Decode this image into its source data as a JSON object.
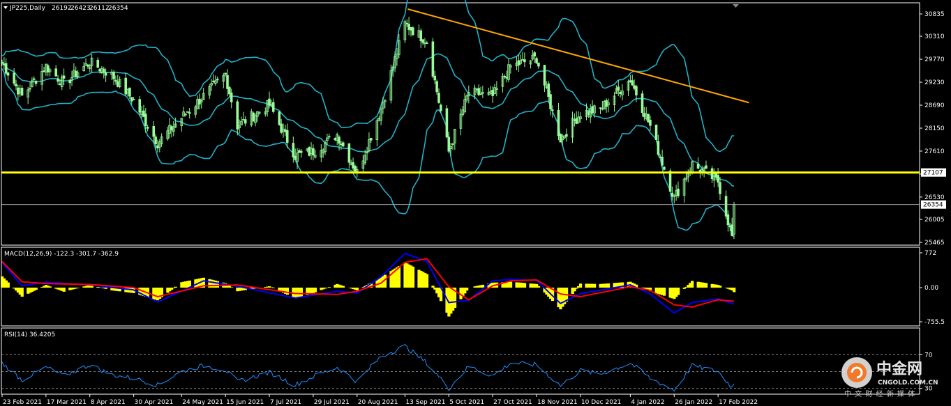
{
  "colors": {
    "background": "#000000",
    "frame": "#ffffff",
    "candle": "#98fb98",
    "bollinger": "#20b2c8",
    "trendline": "#ffa500",
    "support": "#ffff00",
    "macd_hist": "#ffff00",
    "macd_main": "#0000ff",
    "macd_signal": "#ff0000",
    "rsi": "#1e90ff"
  },
  "chart_data": [
    {
      "type": "candlestick",
      "symbol_header": "JP225,Daily",
      "ohlc_header": [
        "26192",
        "26423",
        "26112",
        "26354"
      ],
      "y_ticks": [
        "30835",
        "30310",
        "29770",
        "29230",
        "28690",
        "28150",
        "27610",
        "27070",
        "26530",
        "26005",
        "25465"
      ],
      "ylim": [
        25465,
        30835
      ],
      "support_level": 27107,
      "support_label": "27107",
      "last_price": 26354,
      "last_price_label": "26354",
      "trendline": {
        "from": [
          "13 Sep 2021",
          30950
        ],
        "to": [
          "~22 Feb 2022",
          28750
        ]
      },
      "x_tick_labels": [
        "23 Feb 2021",
        "17 Mar 2021",
        "8 Apr 2021",
        "30 Apr 2021",
        "24 May 2021",
        "15 Jun 2021",
        "7 Jul 2021",
        "29 Jul 2021",
        "20 Aug 2021",
        "13 Sep 2021",
        "5 Oct 2021",
        "27 Oct 2021",
        "18 Nov 2021",
        "10 Dec 2021",
        "4 Jan 2022",
        "26 Jan 2022",
        "17 Feb 2022"
      ],
      "close_path": [
        [
          "23 Feb 2021",
          29700
        ],
        [
          "5 Mar 2021",
          28900
        ],
        [
          "17 Mar 2021",
          29600
        ],
        [
          "26 Mar 2021",
          29200
        ],
        [
          "8 Apr 2021",
          29700
        ],
        [
          "19 Apr 2021",
          29400
        ],
        [
          "30 Apr 2021",
          28800
        ],
        [
          "12 May 2021",
          27800
        ],
        [
          "24 May 2021",
          28400
        ],
        [
          "4 Jun 2021",
          28900
        ],
        [
          "15 Jun 2021",
          29400
        ],
        [
          "21 Jun 2021",
          28200
        ],
        [
          "7 Jul 2021",
          28700
        ],
        [
          "20 Jul 2021",
          27500
        ],
        [
          "29 Jul 2021",
          27600
        ],
        [
          "10 Aug 2021",
          28000
        ],
        [
          "20 Aug 2021",
          27100
        ],
        [
          "1 Sep 2021",
          28600
        ],
        [
          "13 Sep 2021",
          30600
        ],
        [
          "24 Sep 2021",
          30200
        ],
        [
          "5 Oct 2021",
          27600
        ],
        [
          "15 Oct 2021",
          29000
        ],
        [
          "27 Oct 2021",
          28900
        ],
        [
          "5 Nov 2021",
          29600
        ],
        [
          "18 Nov 2021",
          29800
        ],
        [
          "30 Nov 2021",
          27900
        ],
        [
          "10 Dec 2021",
          28500
        ],
        [
          "20 Dec 2021",
          28600
        ],
        [
          "4 Jan 2022",
          29300
        ],
        [
          "14 Jan 2022",
          28200
        ],
        [
          "26 Jan 2022",
          26500
        ],
        [
          "4 Feb 2022",
          27300
        ],
        [
          "17 Feb 2022",
          26900
        ],
        [
          "24 Feb 2022",
          25600
        ],
        [
          "25 Feb 2022",
          26354
        ]
      ]
    },
    {
      "type": "histogram+line",
      "title": "MACD(12,26,9) -122.3 -301.7 -362.9",
      "y_ticks": [
        "772",
        "0.00",
        "-755.5"
      ],
      "ylim": [
        -755.5,
        772
      ],
      "histogram": [
        [
          "23 Feb 2021",
          250
        ],
        [
          "5 Mar 2021",
          -200
        ],
        [
          "17 Mar 2021",
          60
        ],
        [
          "26 Mar 2021",
          -90
        ],
        [
          "8 Apr 2021",
          60
        ],
        [
          "19 Apr 2021",
          -60
        ],
        [
          "30 Apr 2021",
          -120
        ],
        [
          "12 May 2021",
          -280
        ],
        [
          "24 May 2021",
          120
        ],
        [
          "4 Jun 2021",
          220
        ],
        [
          "15 Jun 2021",
          100
        ],
        [
          "21 Jun 2021",
          -80
        ],
        [
          "7 Jul 2021",
          30
        ],
        [
          "20 Jul 2021",
          -240
        ],
        [
          "29 Jul 2021",
          -120
        ],
        [
          "10 Aug 2021",
          80
        ],
        [
          "20 Aug 2021",
          -60
        ],
        [
          "1 Sep 2021",
          230
        ],
        [
          "13 Sep 2021",
          560
        ],
        [
          "24 Sep 2021",
          300
        ],
        [
          "5 Oct 2021",
          -640
        ],
        [
          "15 Oct 2021",
          0
        ],
        [
          "27 Oct 2021",
          110
        ],
        [
          "5 Nov 2021",
          130
        ],
        [
          "18 Nov 2021",
          80
        ],
        [
          "30 Nov 2021",
          -480
        ],
        [
          "10 Dec 2021",
          90
        ],
        [
          "20 Dec 2021",
          80
        ],
        [
          "4 Jan 2022",
          130
        ],
        [
          "14 Jan 2022",
          -80
        ],
        [
          "26 Jan 2022",
          -250
        ],
        [
          "4 Feb 2022",
          150
        ],
        [
          "17 Feb 2022",
          60
        ],
        [
          "24 Feb 2022",
          -60
        ],
        [
          "25 Feb 2022",
          -100
        ]
      ],
      "series": [
        {
          "values": [
            [
              "23 Feb 2021",
              560
            ],
            [
              "5 Mar 2021",
              40
            ],
            [
              "17 Mar 2021",
              120
            ],
            [
              "8 Apr 2021",
              60
            ],
            [
              "30 Apr 2021",
              -50
            ],
            [
              "12 May 2021",
              -320
            ],
            [
              "4 Jun 2021",
              150
            ],
            [
              "21 Jun 2021",
              30
            ],
            [
              "20 Jul 2021",
              -230
            ],
            [
              "10 Aug 2021",
              -80
            ],
            [
              "20 Aug 2021",
              -120
            ],
            [
              "1 Sep 2021",
              240
            ],
            [
              "13 Sep 2021",
              760
            ],
            [
              "24 Sep 2021",
              580
            ],
            [
              "5 Oct 2021",
              -330
            ],
            [
              "15 Oct 2021",
              -280
            ],
            [
              "27 Oct 2021",
              150
            ],
            [
              "5 Nov 2021",
              180
            ],
            [
              "18 Nov 2021",
              160
            ],
            [
              "30 Nov 2021",
              -350
            ],
            [
              "10 Dec 2021",
              -130
            ],
            [
              "4 Jan 2022",
              60
            ],
            [
              "14 Jan 2022",
              -140
            ],
            [
              "26 Jan 2022",
              -560
            ],
            [
              "4 Feb 2022",
              -330
            ],
            [
              "17 Feb 2022",
              -250
            ],
            [
              "25 Feb 2022",
              -362.9
            ]
          ]
        },
        {
          "values": [
            [
              "23 Feb 2021",
              580
            ],
            [
              "5 Mar 2021",
              130
            ],
            [
              "17 Mar 2021",
              90
            ],
            [
              "8 Apr 2021",
              70
            ],
            [
              "30 Apr 2021",
              0
            ],
            [
              "12 May 2021",
              -200
            ],
            [
              "4 Jun 2021",
              40
            ],
            [
              "21 Jun 2021",
              60
            ],
            [
              "20 Jul 2021",
              -130
            ],
            [
              "10 Aug 2021",
              -150
            ],
            [
              "20 Aug 2021",
              -80
            ],
            [
              "1 Sep 2021",
              100
            ],
            [
              "13 Sep 2021",
              560
            ],
            [
              "24 Sep 2021",
              640
            ],
            [
              "5 Oct 2021",
              20
            ],
            [
              "15 Oct 2021",
              -270
            ],
            [
              "27 Oct 2021",
              40
            ],
            [
              "5 Nov 2021",
              150
            ],
            [
              "18 Nov 2021",
              170
            ],
            [
              "30 Nov 2021",
              -140
            ],
            [
              "10 Dec 2021",
              -200
            ],
            [
              "4 Jan 2022",
              20
            ],
            [
              "14 Jan 2022",
              -60
            ],
            [
              "26 Jan 2022",
              -380
            ],
            [
              "4 Feb 2022",
              -430
            ],
            [
              "17 Feb 2022",
              -270
            ],
            [
              "25 Feb 2022",
              -301.7
            ]
          ]
        }
      ]
    },
    {
      "type": "line",
      "title": "RSI(14) 36.4205",
      "y_ticks": [
        "70",
        "30"
      ],
      "ylim": [
        0,
        100
      ],
      "levels": [
        70,
        50,
        30
      ],
      "series": [
        {
          "values": [
            [
              "23 Feb 2021",
              60
            ],
            [
              "5 Mar 2021",
              40
            ],
            [
              "17 Mar 2021",
              55
            ],
            [
              "26 Mar 2021",
              45
            ],
            [
              "8 Apr 2021",
              58
            ],
            [
              "19 Apr 2021",
              46
            ],
            [
              "30 Apr 2021",
              42
            ],
            [
              "12 May 2021",
              34
            ],
            [
              "24 May 2021",
              50
            ],
            [
              "4 Jun 2021",
              57
            ],
            [
              "15 Jun 2021",
              52
            ],
            [
              "21 Jun 2021",
              38
            ],
            [
              "7 Jul 2021",
              49
            ],
            [
              "20 Jul 2021",
              34
            ],
            [
              "29 Jul 2021",
              44
            ],
            [
              "10 Aug 2021",
              55
            ],
            [
              "20 Aug 2021",
              38
            ],
            [
              "1 Sep 2021",
              68
            ],
            [
              "13 Sep 2021",
              80
            ],
            [
              "24 Sep 2021",
              60
            ],
            [
              "5 Oct 2021",
              30
            ],
            [
              "15 Oct 2021",
              56
            ],
            [
              "27 Oct 2021",
              45
            ],
            [
              "5 Nov 2021",
              60
            ],
            [
              "18 Nov 2021",
              58
            ],
            [
              "30 Nov 2021",
              33
            ],
            [
              "10 Dec 2021",
              51
            ],
            [
              "20 Dec 2021",
              47
            ],
            [
              "4 Jan 2022",
              60
            ],
            [
              "14 Jan 2022",
              42
            ],
            [
              "26 Jan 2022",
              28
            ],
            [
              "4 Feb 2022",
              57
            ],
            [
              "17 Feb 2022",
              50
            ],
            [
              "24 Feb 2022",
              31
            ],
            [
              "25 Feb 2022",
              36.4205
            ]
          ]
        }
      ]
    }
  ],
  "watermark": {
    "title": "中金网",
    "domain": "CNGOLD.COM.CN",
    "subtitle": "中 文 财 经 新 媒 体"
  }
}
